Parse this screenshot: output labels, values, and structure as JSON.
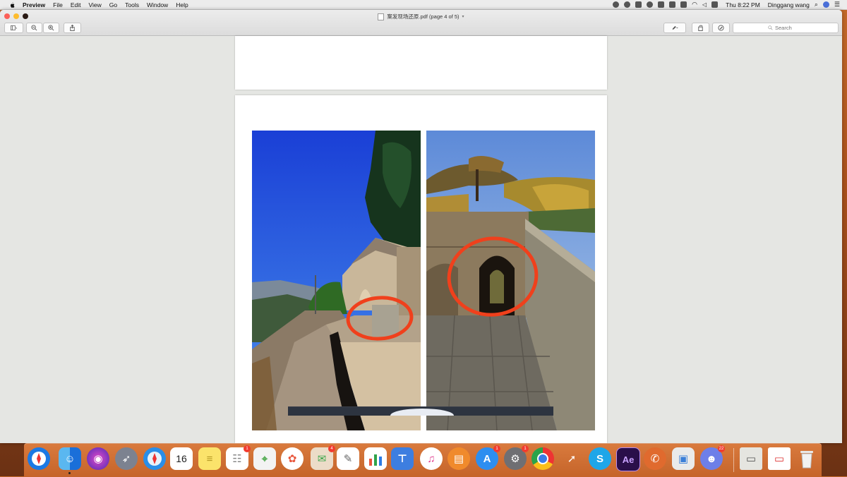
{
  "menubar": {
    "app_name": "Preview",
    "menus": [
      "File",
      "Edit",
      "View",
      "Go",
      "Tools",
      "Window",
      "Help"
    ],
    "clock": "Thu 8:22 PM",
    "user": "Dinggang wang"
  },
  "window": {
    "title": "案发现场还原.pdf (page 4 of 5)",
    "search_placeholder": "Search"
  },
  "document": {
    "current_page": 4,
    "total_pages": 5,
    "annotation_color": "#f0401c"
  },
  "dock": {
    "calendar_date": "16",
    "badges": {
      "reminders": "1",
      "messages": "4",
      "app_store": "1",
      "system_prefs": "1",
      "discord": "22"
    }
  }
}
